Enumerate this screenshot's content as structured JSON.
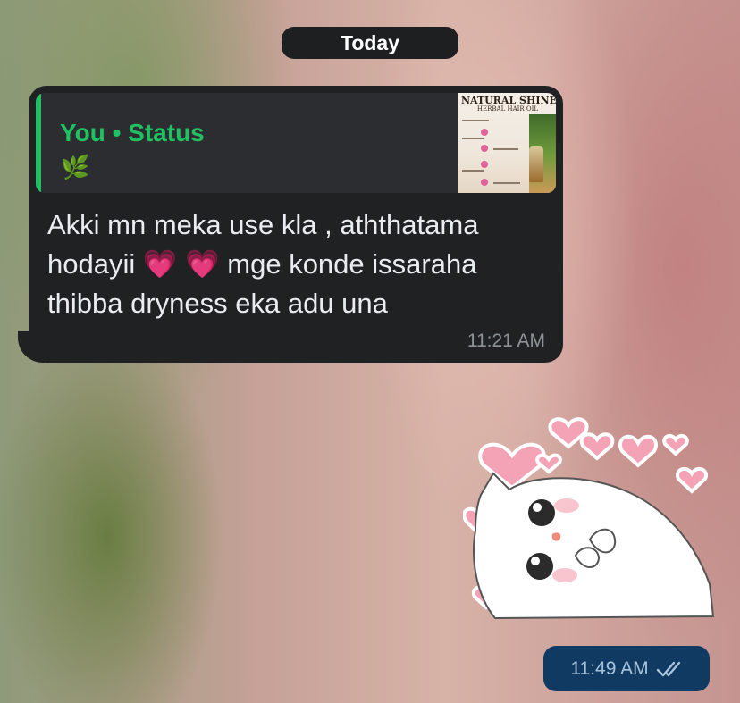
{
  "date_separator": "Today",
  "incoming_message": {
    "quote": {
      "title": "You • Status",
      "emoji": "🌿",
      "thumbnail": {
        "title": "NATURAL SHINE",
        "subtitle": "HERBAL HAIR OIL"
      }
    },
    "text": "Akki mn meka use kla , aththatama hodayii 💗 💗 mge konde issaraha thibba dryness eka adu una",
    "time": "11:21 AM"
  },
  "sticker": {
    "icon": "cat-with-hearts-sticker"
  },
  "outgoing_message": {
    "time": "11:49 AM",
    "status_icon": "double-check-icon"
  },
  "colors": {
    "incoming_bubble": "#202123",
    "quote_accent": "#21c063",
    "outgoing_bubble": "#103a62"
  }
}
